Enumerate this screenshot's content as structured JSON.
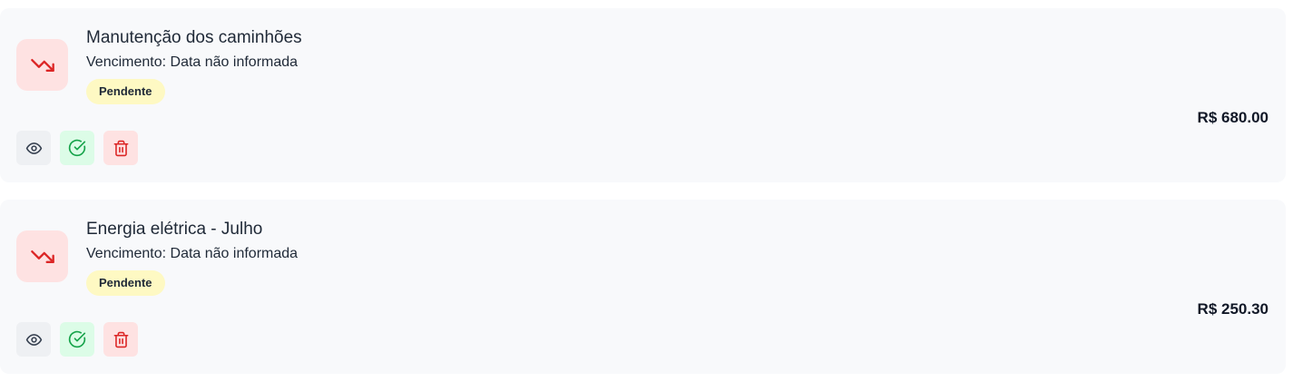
{
  "colors": {
    "expense_icon": "#dc2626",
    "expense_icon_bg": "#fee2e2",
    "pending_badge_bg": "#fef9c3",
    "view_icon": "#374151",
    "pay_icon": "#16a34a",
    "delete_icon": "#dc2626",
    "card_bg": "#f8f9fb"
  },
  "bills": [
    {
      "title": "Manutenção dos caminhões",
      "due_label": "Vencimento:",
      "due_value": "Data não informada",
      "status": "Pendente",
      "amount": "R$ 680.00",
      "icon": "trending-down-icon",
      "actions": [
        "eye-icon",
        "check-circle-icon",
        "trash-icon"
      ]
    },
    {
      "title": "Energia elétrica - Julho",
      "due_label": "Vencimento:",
      "due_value": "Data não informada",
      "status": "Pendente",
      "amount": "R$ 250.30",
      "icon": "trending-down-icon",
      "actions": [
        "eye-icon",
        "check-circle-icon",
        "trash-icon"
      ]
    }
  ]
}
